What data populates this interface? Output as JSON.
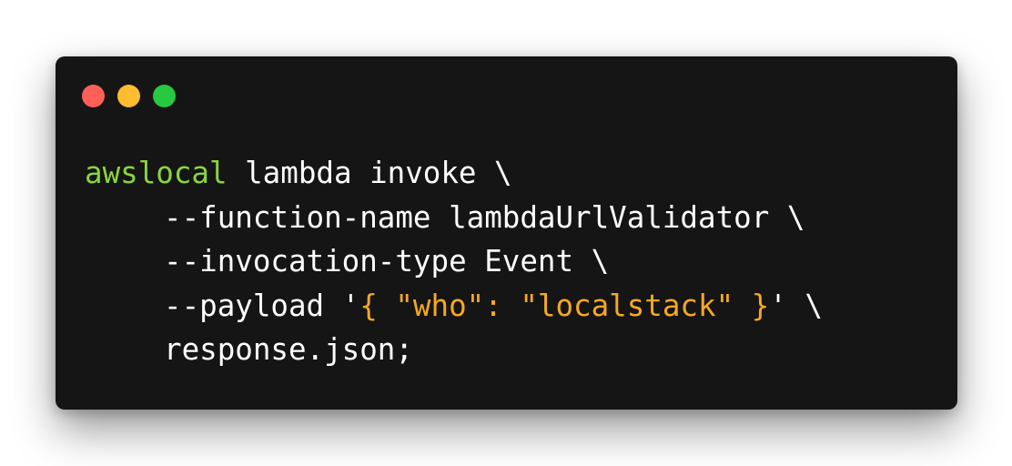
{
  "window": {
    "traffic_lights": [
      {
        "name": "close",
        "color": "#ff5f57"
      },
      {
        "name": "minimize",
        "color": "#febc2e"
      },
      {
        "name": "maximize",
        "color": "#28c840"
      }
    ]
  },
  "code": {
    "colors": {
      "text": "#ffffff",
      "command": "#8bd43c",
      "string": "#f6a823"
    },
    "line1": {
      "command": "awslocal",
      "rest": " lambda invoke \\"
    },
    "line2": "--function-name lambdaUrlValidator \\",
    "line3": "--invocation-type Event \\",
    "line4": {
      "pre": "--payload '",
      "json": "{ \"who\": \"localstack\" }",
      "post": "' \\"
    },
    "line5": "response.json;"
  }
}
